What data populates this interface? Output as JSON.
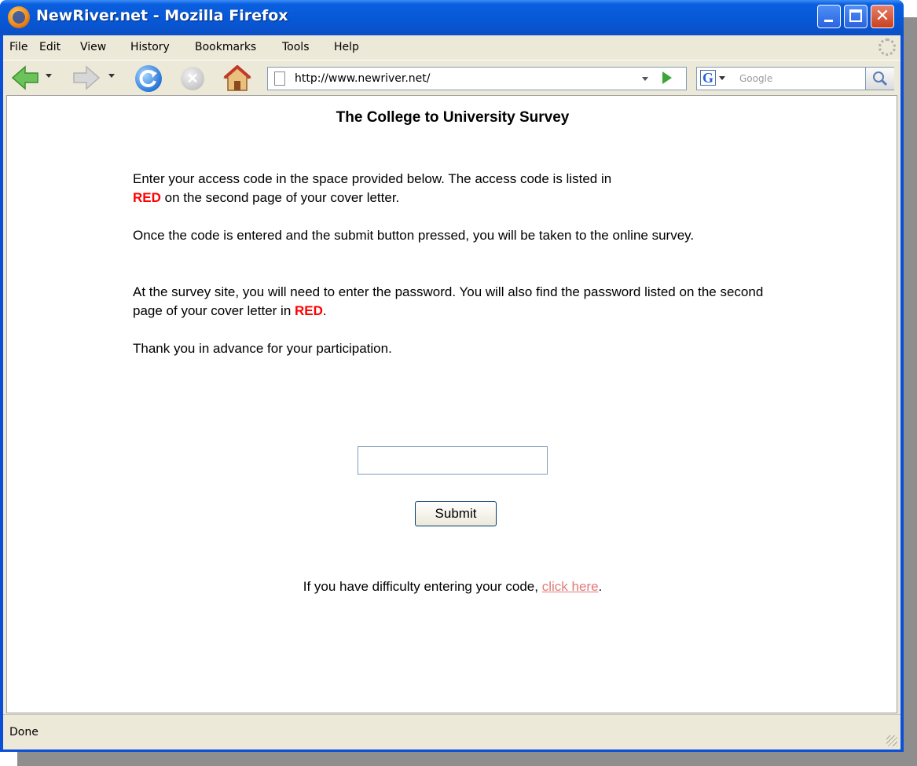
{
  "window": {
    "title": "NewRiver.net - Mozilla Firefox",
    "buttons": [
      "minimize-icon",
      "maximize-icon",
      "close-icon"
    ]
  },
  "menubar": {
    "items": [
      {
        "label": "File"
      },
      {
        "label": "Edit"
      },
      {
        "label": "View"
      },
      {
        "label": "History"
      },
      {
        "label": "Bookmarks"
      },
      {
        "label": "Tools"
      },
      {
        "label": "Help"
      }
    ]
  },
  "navbar": {
    "url": "http://www.newriver.net/",
    "search_placeholder": "Google",
    "search_engine_letter": "G"
  },
  "page": {
    "title": "The College to University Survey",
    "para1_a": "Enter your access code in the space provided below. The access code is listed in",
    "para1_red": "RED",
    "para1_b": " on the second page of your cover letter.",
    "para2": "Once the code is entered and the submit button pressed, you will be taken to the online survey.",
    "para3_a": "At the survey site, you will need to enter the password. You will also find the password listed on the second page of your cover letter in ",
    "para3_red": "RED",
    "para3_b": ".",
    "para4": "Thank you in advance for your participation.",
    "access_code_value": "",
    "submit_label": "Submit",
    "help_text": "If you have difficulty entering your code, ",
    "help_link": "click here",
    "help_end": "."
  },
  "status": {
    "text": "Done"
  },
  "colors": {
    "highlight_red": "#ff0000",
    "link": "#e07a7a",
    "titlebar": "#0758d6"
  }
}
